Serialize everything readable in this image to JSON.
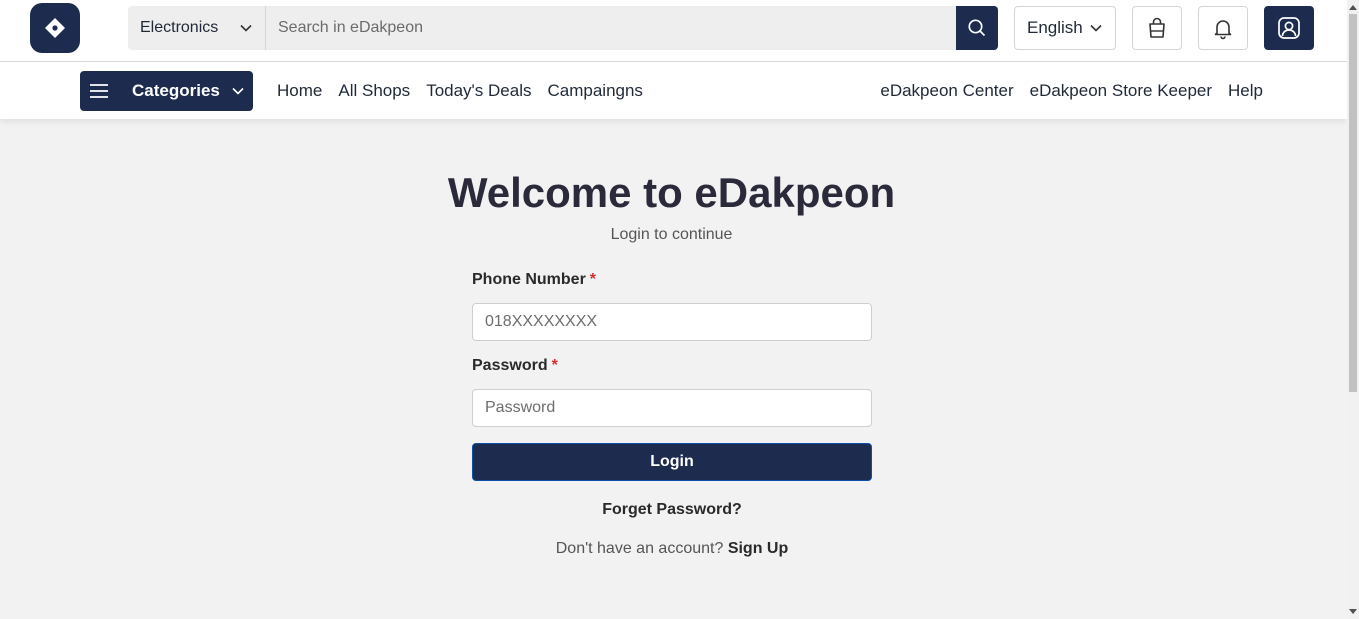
{
  "header": {
    "logo_icon": "diamond-logo-icon",
    "category_select": {
      "value": "Electronics",
      "icon": "chevron-down-icon"
    },
    "search": {
      "placeholder": "Search in eDakpeon",
      "value": "",
      "button_icon": "search-icon"
    },
    "language": {
      "value": "English",
      "icon": "chevron-down-icon"
    },
    "icons": [
      "shopping-bag-icon",
      "bell-icon",
      "user-account-icon"
    ]
  },
  "nav": {
    "categories_label": "Categories",
    "left_links": [
      "Home",
      "All Shops",
      "Today's Deals",
      "Campaingns"
    ],
    "right_links": [
      "eDakpeon Center",
      "eDakpeon Store Keeper",
      "Help"
    ]
  },
  "login": {
    "title": "Welcome to eDakpeon",
    "subtitle": "Login to continue",
    "phone": {
      "label": "Phone Number",
      "required_mark": "*",
      "placeholder": "018XXXXXXXX",
      "value": ""
    },
    "password": {
      "label": "Password",
      "required_mark": "*",
      "placeholder": "Password",
      "value": ""
    },
    "submit_label": "Login",
    "forget_label": "Forget Password?",
    "signup_prompt": "Don't have an account?",
    "signup_label": "Sign Up"
  },
  "colors": {
    "primary": "#1c2b4e",
    "required": "#d32f2f",
    "background": "#f2f2f2"
  }
}
